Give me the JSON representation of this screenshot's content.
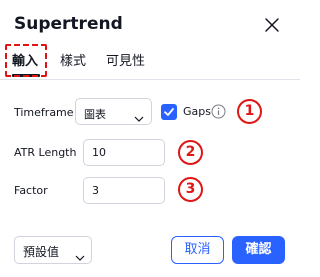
{
  "dialog": {
    "title": "Supertrend",
    "close_icon": "close-icon"
  },
  "tabs": [
    {
      "label": "輸入",
      "active": true
    },
    {
      "label": "樣式",
      "active": false
    },
    {
      "label": "可見性",
      "active": false
    }
  ],
  "inputs": {
    "timeframe": {
      "label": "Timeframe",
      "value": "圖表",
      "gaps_checked": true,
      "gaps_label": "Gaps",
      "info_icon": "info-icon"
    },
    "atr_length": {
      "label": "ATR Length",
      "value": "10"
    },
    "factor": {
      "label": "Factor",
      "value": "3"
    }
  },
  "annotations": [
    "1",
    "2",
    "3"
  ],
  "footer": {
    "defaults_value": "預設值",
    "cancel_label": "取消",
    "ok_label": "確認"
  },
  "colors": {
    "accent": "#2962ff",
    "annotation": "#e01515",
    "text": "#131722",
    "border": "#d1d4dc"
  }
}
